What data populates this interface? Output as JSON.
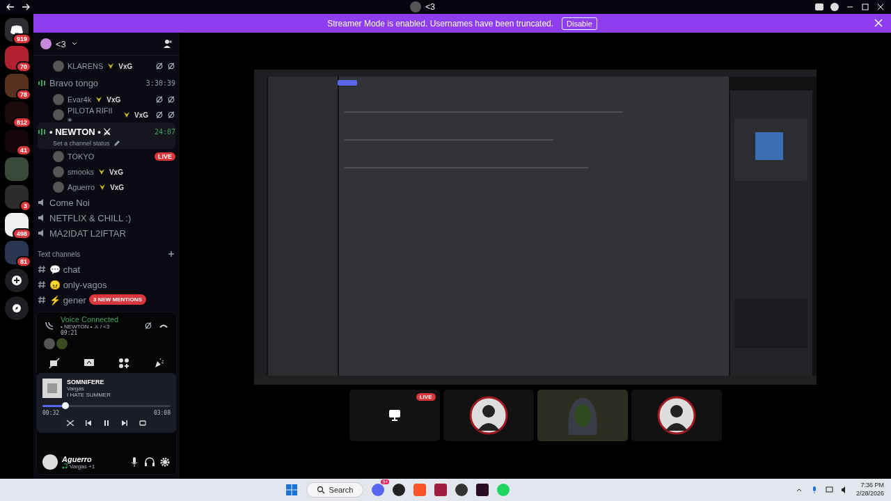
{
  "titlebar": {
    "title": "<3"
  },
  "banner": {
    "text": "Streamer Mode is enabled. Usernames have been truncated.",
    "button": "Disable"
  },
  "servers": [
    {
      "kind": "home",
      "badge": "919",
      "color": "#2b2d31"
    },
    {
      "kind": "server",
      "badge": "70",
      "color": "#b3202f"
    },
    {
      "kind": "server",
      "badge": "78",
      "color": "#5a3020"
    },
    {
      "kind": "server",
      "badge": "812",
      "color": "#1a0a0c"
    },
    {
      "kind": "server",
      "badge": "41",
      "color": "#140608"
    },
    {
      "kind": "server",
      "color": "#3a4a3a"
    },
    {
      "kind": "server",
      "badge": "3",
      "color": "#2c2c2c"
    },
    {
      "kind": "server",
      "badge": "498",
      "color": "#f0f0f0"
    },
    {
      "kind": "server",
      "badge": "81",
      "color": "#2a3550"
    }
  ],
  "server_header": {
    "name": "<3"
  },
  "channels": [
    {
      "kind": "member",
      "name": "KLARENS",
      "tag": "VxG",
      "muted": true,
      "deafened": true
    },
    {
      "kind": "voice",
      "name": "Bravo tongo",
      "timer": "3:30:39",
      "selected": false,
      "children": [
        {
          "kind": "member",
          "name": "Evar4k",
          "tag": "VxG",
          "muted": true,
          "deafened": true
        },
        {
          "kind": "member",
          "name": "PILOTA RIFII ⚹",
          "tag": "VxG",
          "muted": true,
          "deafened": true
        }
      ]
    },
    {
      "kind": "voice",
      "name": "• NEWTON • ⚔",
      "timer": "24:07",
      "status": "Set a channel status",
      "selected": true,
      "children": [
        {
          "kind": "member",
          "name": "TOKYO",
          "badge": "LIVE",
          "muted": false,
          "deafened": false
        },
        {
          "kind": "member",
          "name": "smooks",
          "tag": "VxG",
          "muted": false,
          "deafened": false
        },
        {
          "kind": "member",
          "name": "Aguerro",
          "tag": "VxG",
          "muted": false,
          "deafened": false
        }
      ]
    },
    {
      "kind": "idle_voice",
      "name": "Come Noi"
    },
    {
      "kind": "idle_voice",
      "name": "NETFLIX & CHILL :)"
    },
    {
      "kind": "idle_voice",
      "name": "MA2IDAT L2IFTAR"
    },
    {
      "kind": "category",
      "name": "Text channels"
    },
    {
      "kind": "text",
      "name": "chat",
      "emoji": "💬"
    },
    {
      "kind": "text",
      "name": "only-vagos",
      "emoji": "😠"
    },
    {
      "kind": "text",
      "name": "gener",
      "emoji": "⚡"
    }
  ],
  "mentions": "3 NEW MENTIONS",
  "voice": {
    "status": "Voice Connected",
    "channel": "• NEWTON • ⚔ / <3",
    "time": "09:21"
  },
  "music": {
    "title": "SOMNIFERE",
    "artist": "Vargas",
    "album": "I HATE SUMMER",
    "level": 0.18,
    "elapsed": "00:32",
    "total": "03:08"
  },
  "user": {
    "name": "Aguerro",
    "activity": "Vargas +1"
  },
  "stage": {
    "tiles": [
      {
        "kind": "stream",
        "badge": "LIVE"
      },
      {
        "kind": "avatar"
      },
      {
        "kind": "hooded"
      },
      {
        "kind": "avatar"
      }
    ]
  },
  "taskbar": {
    "search": "Search",
    "badge": "9+",
    "time": "7:36 PM",
    "date": "2/28/2026"
  }
}
